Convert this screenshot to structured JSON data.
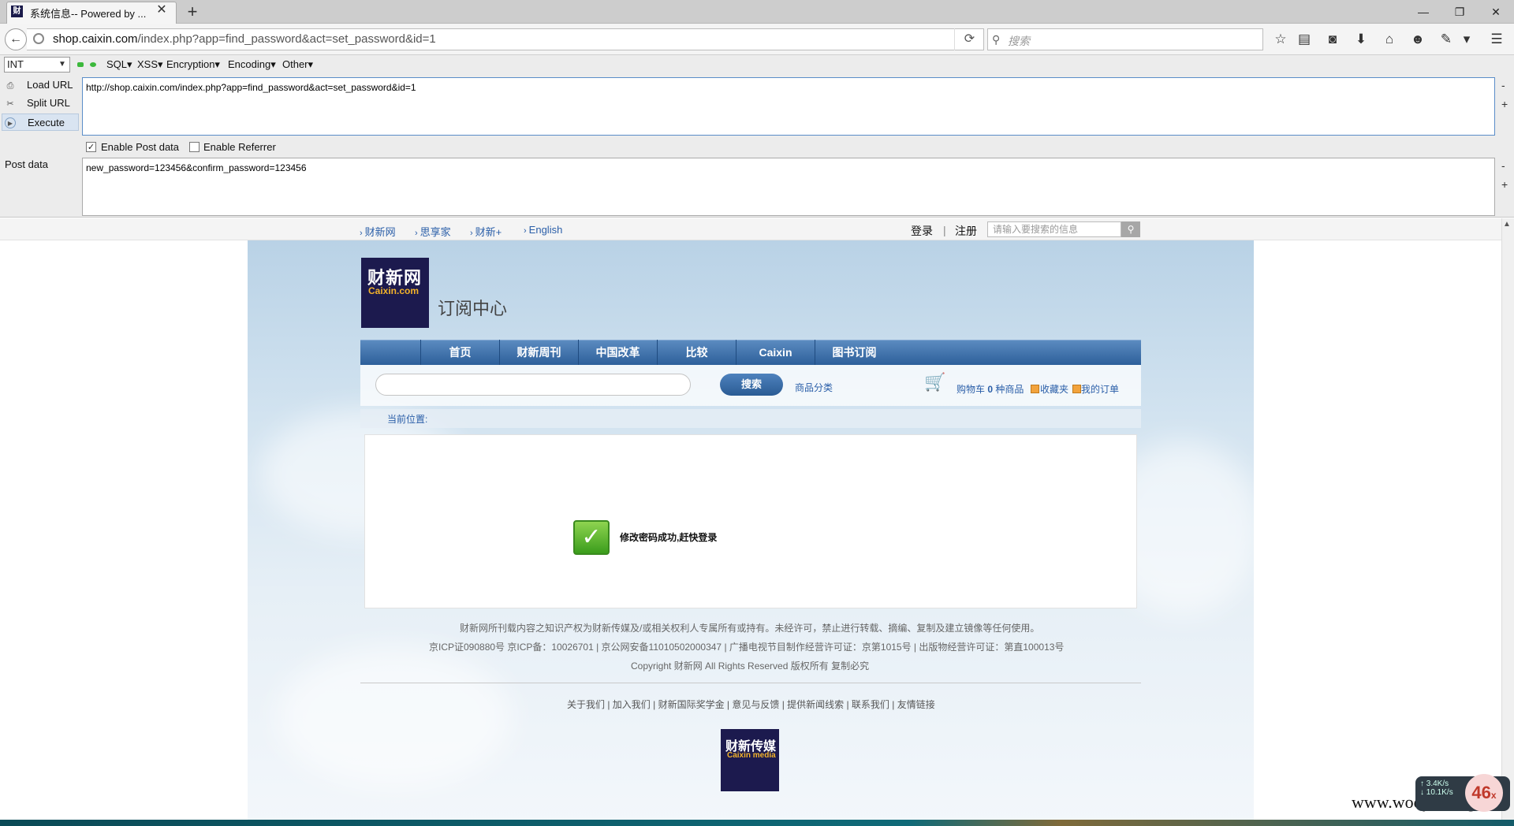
{
  "browser": {
    "tab_title": "系统信息-- Powered by ...",
    "tab_favicon": "财",
    "new_tab_label": "+",
    "window_buttons": [
      "—",
      "❐",
      "✕"
    ],
    "url_host": "shop.caixin.com",
    "url_path": "/index.php?app=find_password&act=set_password&id=1",
    "search_placeholder": "搜索",
    "icons": [
      "star-icon",
      "clipboard-icon",
      "pocket-icon",
      "download-icon",
      "home-icon",
      "chat-icon",
      "extension-icon",
      "menu-icon"
    ]
  },
  "hackbar": {
    "select_value": "INT",
    "menus": [
      "SQL▾",
      "XSS▾",
      "Encryption▾",
      "Encoding▾",
      "Other▾"
    ],
    "load_url": "Load URL",
    "split_url": "Split URL",
    "execute": "Execute",
    "url_value": "http://shop.caixin.com/index.php?app=find_password&act=set_password&id=1",
    "enable_post_label": "Enable Post data",
    "enable_post_checked": true,
    "enable_referrer_label": "Enable Referrer",
    "enable_referrer_checked": false,
    "post_label": "Post data",
    "post_value": "new_password=123456&confirm_password=123456"
  },
  "site": {
    "top_links": [
      "财新网",
      "思享家",
      "财新+",
      "English"
    ],
    "login": "登录",
    "separator": "|",
    "register": "注册",
    "top_search_placeholder": "请输入要搜索的信息",
    "logo_cn": "财新网",
    "logo_en": "Caixin.com",
    "logo_sub": "订阅中心",
    "nav": [
      "首页",
      "财新周刊",
      "中国改革",
      "比较",
      "Caixin",
      "图书订阅"
    ],
    "search_button": "搜索",
    "category_link": "商品分类",
    "cart_prefix": "购物车",
    "cart_count": "0",
    "cart_suffix": "种商品",
    "favorites": "收藏夹",
    "my_orders": "我的订单",
    "breadcrumb": "当前位置:",
    "success_message": "修改密码成功,赶快登录",
    "footer_line1": "财新网所刊载内容之知识产权为财新传媒及/或相关权利人专属所有或持有。未经许可，禁止进行转载、摘编、复制及建立镜像等任何使用。",
    "footer_line2": "京ICP证090880号 京ICP备：10026701 | 京公网安备11010502000347 | 广播电视节目制作经营许可证：京第1015号 | 出版物经营许可证：第直100013号",
    "footer_line3": "Copyright 财新网 All Rights Reserved 版权所有 复制必究",
    "footer_links": "关于我们 | 加入我们 | 财新国际奖学金 | 意见与反馈 | 提供新闻线索 | 联系我们 | 友情链接",
    "footer_logo_cn": "财新传媒",
    "footer_logo_en": "Caixin media"
  },
  "overlay": {
    "net_up": "↑ 3.4K/s",
    "net_down": "↓ 10.1K/s",
    "badge": "46",
    "badge_suffix": "x",
    "watermark": "www.wooyun.org"
  }
}
